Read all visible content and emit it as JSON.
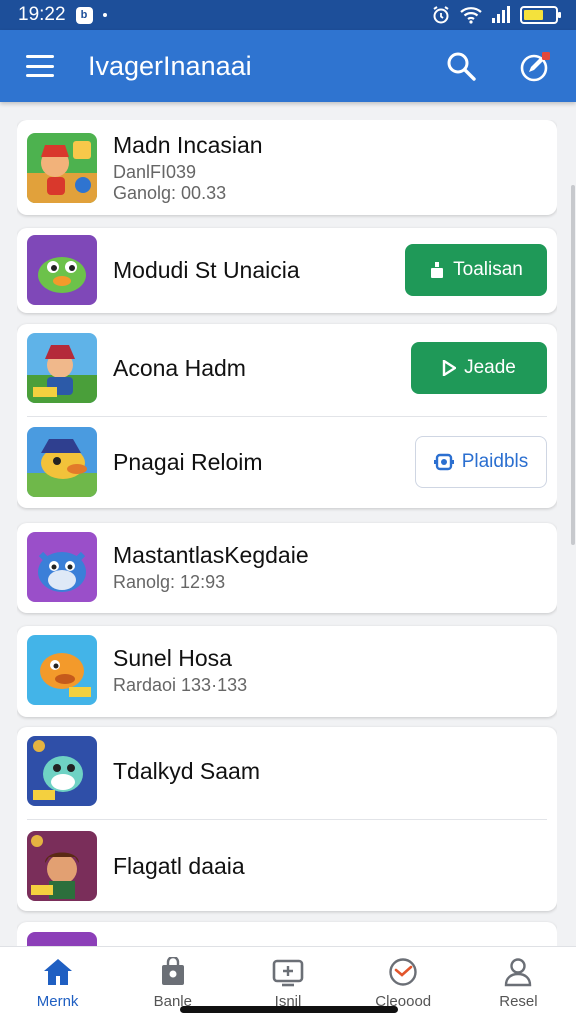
{
  "status_bar": {
    "time": "19:22",
    "app_icon": "b"
  },
  "app_bar": {
    "title": "IvagerInanaai",
    "icons": [
      "menu-icon",
      "search-icon",
      "edit-icon"
    ]
  },
  "rows": [
    {
      "title": "Madn Incasian",
      "subtitle_1": "DanlFI039",
      "subtitle_2": "Ganolg: 00.33"
    },
    {
      "title": "Modudi St Unaicia",
      "button": "Toalisan"
    },
    {
      "title": "Acona Hadm",
      "button": "Jeade"
    },
    {
      "title": "Pnagai Reloim",
      "button": "Plaidbls"
    },
    {
      "title": "MastantlasKegdaie",
      "subtitle_1": "Ranolg: 12:93"
    },
    {
      "title": "Sunel Hosa",
      "subtitle_1": "Rardaoi 133·133"
    },
    {
      "title": "Tdalkyd Saam"
    },
    {
      "title": "Flagatl daaia"
    }
  ],
  "bottom_nav": [
    {
      "label": "Mernk",
      "icon": "home-icon",
      "active": true
    },
    {
      "label": "Banle",
      "icon": "bag-icon"
    },
    {
      "label": "Isnil",
      "icon": "tv-icon"
    },
    {
      "label": "Cleoood",
      "icon": "clock-icon"
    },
    {
      "label": "Resel",
      "icon": "person-icon"
    }
  ],
  "colors": {
    "app_bar": "#2f74d0",
    "status_bar": "#1d4f9a",
    "accent_green": "#1f9958",
    "active_nav": "#1f5fc2"
  }
}
